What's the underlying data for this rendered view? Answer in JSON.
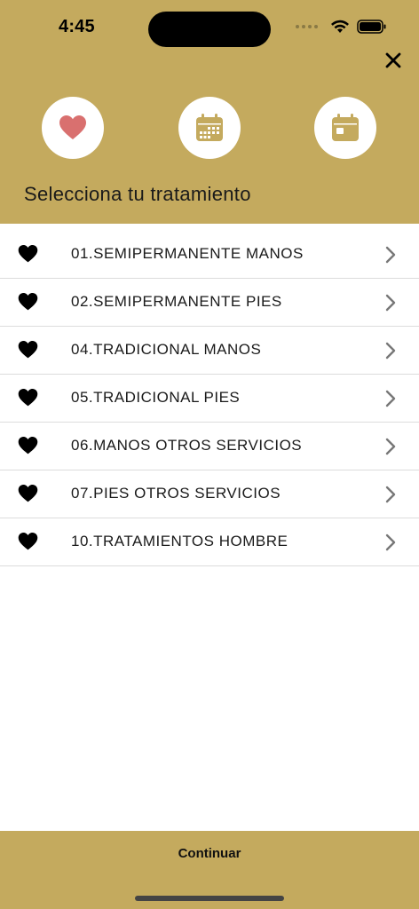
{
  "status_bar": {
    "time": "4:45",
    "icons": [
      "signal-dots-icon",
      "wifi-icon",
      "battery-icon"
    ]
  },
  "header": {
    "title": "Selecciona tu tratamiento",
    "close_icon": "close-icon",
    "steps": [
      {
        "icon": "heart-icon",
        "active": true
      },
      {
        "icon": "calendar-grid-icon",
        "active": false
      },
      {
        "icon": "calendar-day-icon",
        "active": false
      }
    ]
  },
  "treatments": [
    {
      "label": "01.SEMIPERMANENTE MANOS"
    },
    {
      "label": "02.SEMIPERMANENTE PIES"
    },
    {
      "label": "04.TRADICIONAL MANOS"
    },
    {
      "label": "05.TRADICIONAL PIES"
    },
    {
      "label": "06.MANOS OTROS SERVICIOS"
    },
    {
      "label": "07.PIES OTROS SERVICIOS"
    },
    {
      "label": "10.TRATAMIENTOS HOMBRE"
    }
  ],
  "footer": {
    "continue_label": "Continuar"
  },
  "colors": {
    "brand_gold": "#c4aa5e",
    "active_heart": "#d9706f",
    "inactive_icon": "#c4aa5e"
  }
}
